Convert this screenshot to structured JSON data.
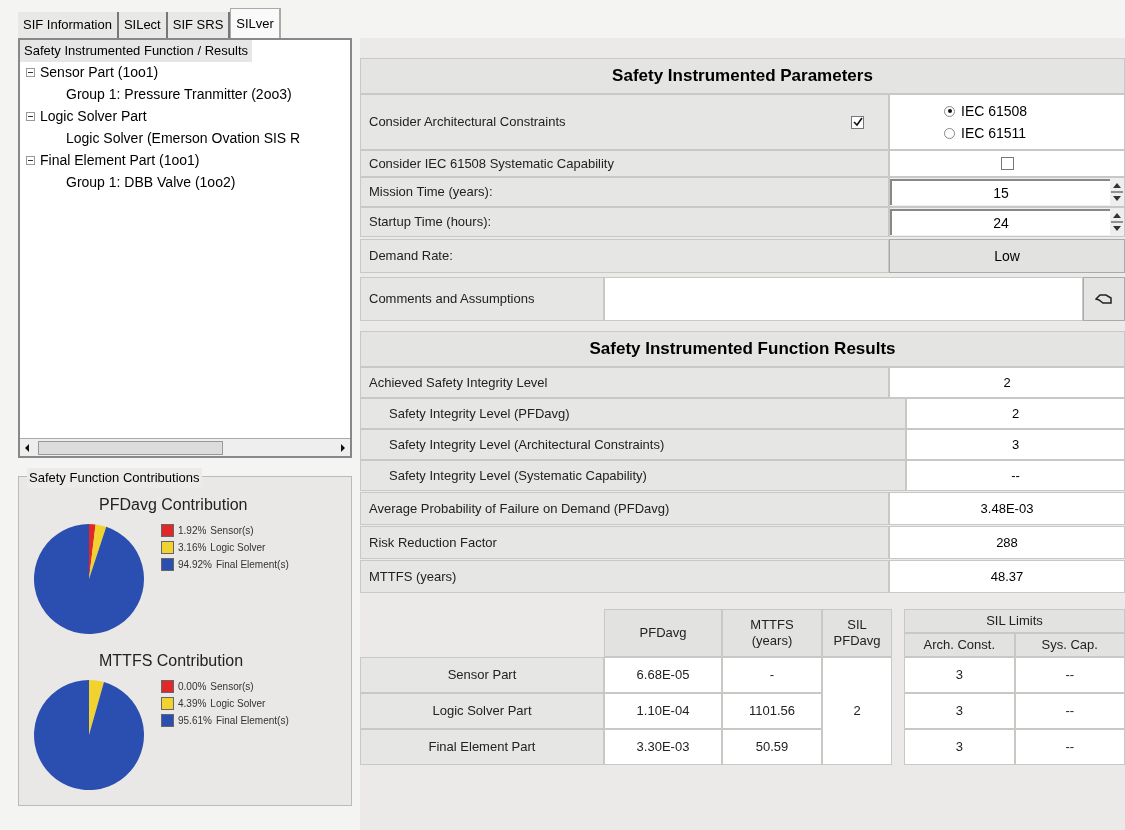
{
  "tabs": [
    {
      "label": "SIF Information",
      "selected": false
    },
    {
      "label": "SILect",
      "selected": false
    },
    {
      "label": "SIF SRS",
      "selected": false
    },
    {
      "label": "SILver",
      "selected": true
    }
  ],
  "tree": {
    "header": "Safety Instrumented Function / Results",
    "items": [
      {
        "label": "Sensor Part (1oo1)",
        "expanded": true,
        "children": [
          {
            "label": "Group 1: Pressure Tranmitter (2oo3)"
          }
        ]
      },
      {
        "label": "Logic Solver Part",
        "expanded": true,
        "children": [
          {
            "label": "Logic Solver (Emerson Ovation SIS R"
          }
        ]
      },
      {
        "label": "Final Element Part (1oo1)",
        "expanded": true,
        "children": [
          {
            "label": "Group 1: DBB Valve (1oo2)"
          }
        ]
      }
    ]
  },
  "contributions": {
    "title": "Safety Function Contributions",
    "charts": [
      {
        "legend": [
          {
            "color": "#e02828"
          },
          {
            "color": "#f2d22e"
          },
          {
            "color": "#2a4fb0"
          }
        ],
        "chart_data": {
          "type": "pie",
          "title": "PFDavg Contribution",
          "categories": [
            "Sensor(s)",
            "Logic Solver",
            "Final Element(s)"
          ],
          "values": [
            1.92,
            3.16,
            94.92
          ],
          "value_labels": [
            "1.92%",
            "3.16%",
            "94.92%"
          ]
        }
      },
      {
        "legend": [
          {
            "color": "#e02828"
          },
          {
            "color": "#f2d22e"
          },
          {
            "color": "#2a4fb0"
          }
        ],
        "chart_data": {
          "type": "pie",
          "title": "MTTFS Contribution",
          "categories": [
            "Sensor(s)",
            "Logic Solver",
            "Final Element(s)"
          ],
          "values": [
            0,
            4.39,
            95.61
          ],
          "value_labels": [
            "0.00%",
            "4.39%",
            "95.61%"
          ]
        }
      }
    ]
  },
  "parameters": {
    "title": "Safety Instrumented Parameters",
    "architectural": {
      "label": "Consider Architectural Constraints",
      "checked": true,
      "standards": [
        {
          "label": "IEC 61508",
          "selected": true
        },
        {
          "label": "IEC 61511",
          "selected": false
        }
      ]
    },
    "systematic": {
      "label": "Consider IEC 61508 Systematic Capability",
      "checked": false
    },
    "mission": {
      "label": "Mission Time (years):",
      "value": "15"
    },
    "startup": {
      "label": "Startup Time (hours):",
      "value": "24"
    },
    "demand": {
      "label": "Demand Rate:",
      "value": "Low"
    },
    "comments": {
      "label": "Comments and Assumptions"
    }
  },
  "results": {
    "title": "Safety Instrumented Function Results",
    "rows": [
      {
        "kind": "main",
        "label": "Achieved Safety Integrity Level",
        "value": "2"
      },
      {
        "kind": "sub",
        "label": "Safety Integrity Level (PFDavg)",
        "value": "2"
      },
      {
        "kind": "sub",
        "label": "Safety Integrity Level (Architectural Constraints)",
        "value": "3"
      },
      {
        "kind": "sub",
        "label": "Safety Integrity Level (Systematic Capability)",
        "value": "--"
      },
      {
        "kind": "main",
        "label": "Average Probability of Failure on Demand (PFDavg)",
        "value": "3.48E-03"
      },
      {
        "kind": "main",
        "label": "Risk Reduction Factor",
        "value": "288"
      },
      {
        "kind": "main",
        "label": "MTTFS (years)",
        "value": "48.37"
      }
    ]
  },
  "table": {
    "columns": [
      "PFDavg",
      "MTTFS (years)",
      "SIL PFDavg"
    ],
    "limits_title": "SIL Limits",
    "limits_columns": [
      "Arch. Const.",
      "Sys. Cap."
    ],
    "sil_pfdavg": "2",
    "rows": [
      {
        "label": "Sensor Part",
        "pfdavg": "6.68E-05",
        "mttfs": "-",
        "arch": "3",
        "sys": "--"
      },
      {
        "label": "Logic Solver Part",
        "pfdavg": "1.10E-04",
        "mttfs": "1101.56",
        "arch": "3",
        "sys": "--"
      },
      {
        "label": "Final Element Part",
        "pfdavg": "3.30E-03",
        "mttfs": "50.59",
        "arch": "3",
        "sys": "--"
      }
    ]
  }
}
